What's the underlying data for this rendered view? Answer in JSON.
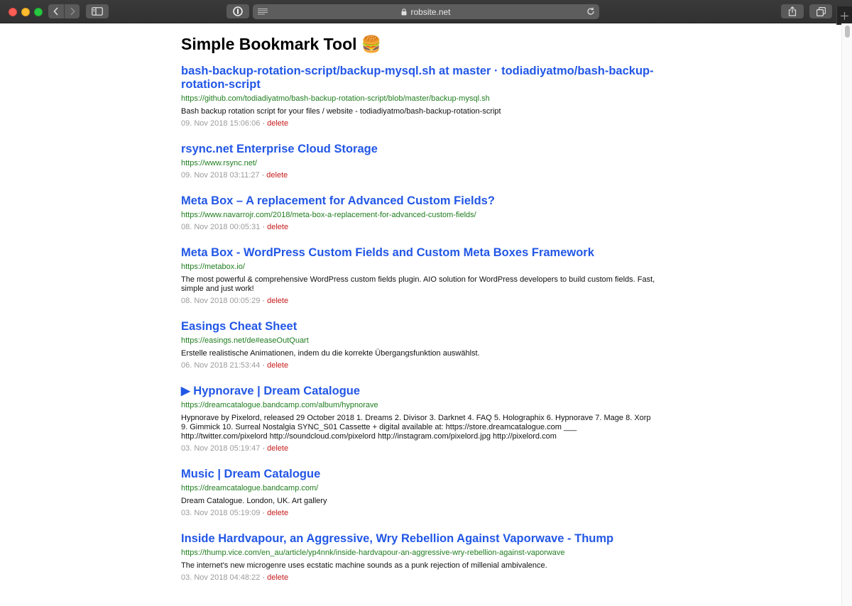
{
  "browser": {
    "address": "robsite.net",
    "colors": {
      "chrome": "#353435",
      "link": "#2257e6",
      "url": "#1f7d1f",
      "delete": "#c61b1b",
      "date": "#9b9b9b"
    }
  },
  "page": {
    "title": "Simple Bookmark Tool 🍔",
    "separator": "·",
    "delete_label": "delete"
  },
  "bookmarks": [
    {
      "title": "bash-backup-rotation-script/backup-mysql.sh at master · todiadiyatmo/bash-backup-rotation-script",
      "url": "https://github.com/todiadiyatmo/bash-backup-rotation-script/blob/master/backup-mysql.sh",
      "desc": "Bash backup rotation script for your files / website - todiadiyatmo/bash-backup-rotation-script",
      "date": "09. Nov 2018 15:06:06"
    },
    {
      "title": "rsync.net Enterprise Cloud Storage",
      "url": "https://www.rsync.net/",
      "desc": "",
      "date": "09. Nov 2018 03:11:27"
    },
    {
      "title": "Meta Box – A replacement for Advanced Custom Fields?",
      "url": "https://www.navarrojr.com/2018/meta-box-a-replacement-for-advanced-custom-fields/",
      "desc": "",
      "date": "08. Nov 2018 00:05:31"
    },
    {
      "title": "Meta Box - WordPress Custom Fields and Custom Meta Boxes Framework",
      "url": "https://metabox.io/",
      "desc": "The most powerful & comprehensive WordPress custom fields plugin. AIO solution for WordPress developers to build custom fields. Fast, simple and just work!",
      "date": "08. Nov 2018 00:05:29"
    },
    {
      "title": "Easings Cheat Sheet",
      "url": "https://easings.net/de#easeOutQuart",
      "desc": "Erstelle realistische Animationen, indem du die korrekte Übergangsfunktion auswählst.",
      "date": "06. Nov 2018 21:53:44"
    },
    {
      "title": "▶︎ Hypnorave | Dream Catalogue",
      "url": "https://dreamcatalogue.bandcamp.com/album/hypnorave",
      "desc": "Hypnorave by Pixelord, released 29 October 2018 1. Dreams 2. Divisor 3. Darknet 4. FAQ 5. Holographix 6. Hypnorave 7. Mage 8. Xorp 9. Gimmick 10. Surreal Nostalgia SYNC_S01 Cassette + digital available at: https://store.dreamcatalogue.com ___ http://twitter.com/pixelord http://soundcloud.com/pixelord http://instagram.com/pixelord.jpg http://pixelord.com",
      "date": "03. Nov 2018 05:19:47"
    },
    {
      "title": "Music | Dream Catalogue",
      "url": "https://dreamcatalogue.bandcamp.com/",
      "desc": "Dream Catalogue. London, UK. Art gallery",
      "date": "03. Nov 2018 05:19:09"
    },
    {
      "title": "Inside Hardvapour, an Aggressive, Wry Rebellion Against Vaporwave - Thump",
      "url": "https://thump.vice.com/en_au/article/yp4nnk/inside-hardvapour-an-aggressive-wry-rebellion-against-vaporwave",
      "desc": "The internet's new microgenre uses ecstatic machine sounds as a punk rejection of millenial ambivalence.",
      "date": "03. Nov 2018 04:48:22"
    }
  ]
}
